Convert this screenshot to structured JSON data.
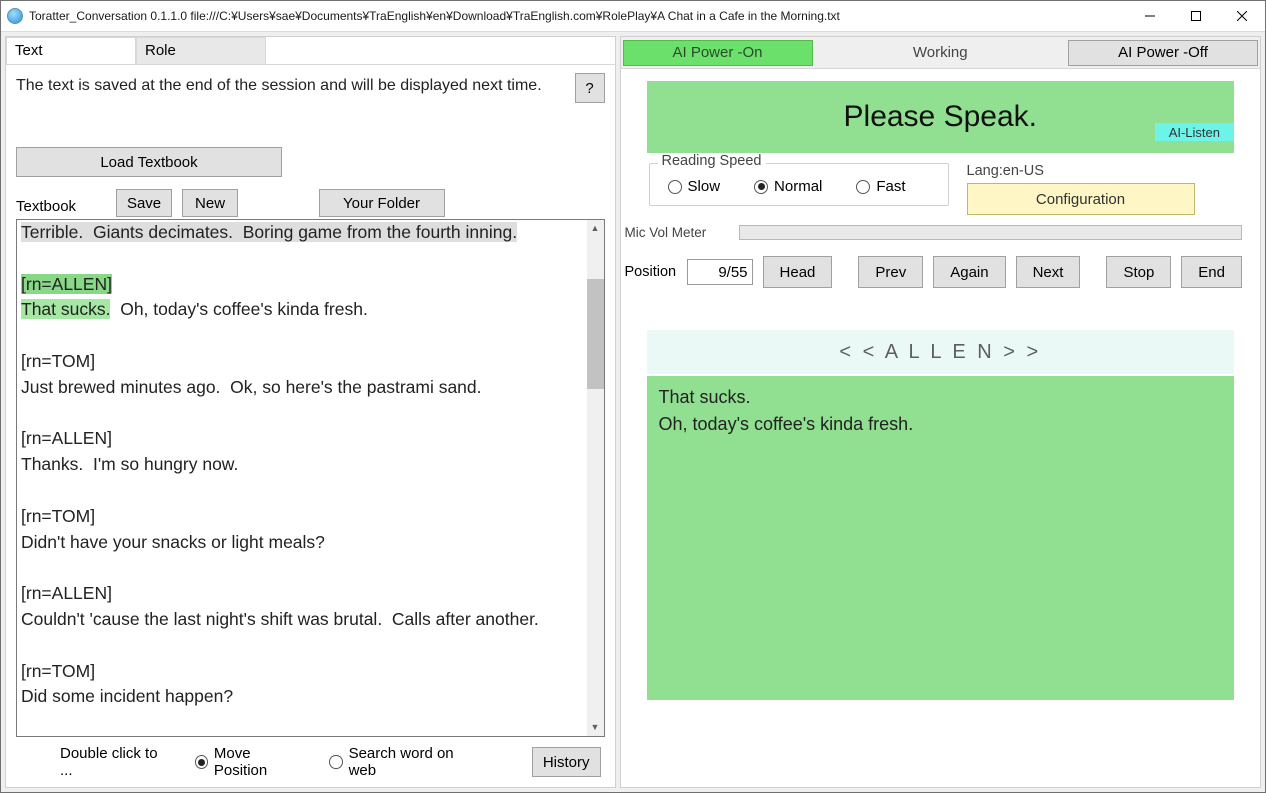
{
  "window": {
    "title": "Toratter_Conversation 0.1.1.0   file:///C:¥Users¥sae¥Documents¥TraEnglish¥en¥Download¥TraEnglish.com¥RolePlay¥A Chat in a Cafe in the Morning.txt"
  },
  "tabs": {
    "text": "Text",
    "role": "Role"
  },
  "left": {
    "save_msg": "The text is saved at the end of the session and will be displayed next time.",
    "help": "?",
    "load_btn": "Load Textbook",
    "textbook_label": "Textbook",
    "save_btn": "Save",
    "new_btn": "New",
    "folder_btn": "Your Folder",
    "textbook_content": {
      "line1": "Terrible.  Giants decimates.  Boring game from the fourth inning.",
      "allen_tag": "[rn=ALLEN]",
      "allen_hl": "That sucks.",
      "allen_rest": "  Oh, today's coffee's kinda fresh.",
      "rest": "\n[rn=TOM]\nJust brewed minutes ago.  Ok, so here's the pastrami sand.\n\n[rn=ALLEN]\nThanks.  I'm so hungry now.\n\n[rn=TOM]\nDidn't have your snacks or light meals?\n\n[rn=ALLEN]\nCouldn't 'cause the last night's shift was brutal.  Calls after another.\n\n[rn=TOM]\nDid some incident happen?"
    },
    "bottom": {
      "dbl": "Double click to ...",
      "move": "Move Position",
      "search": "Search word on web",
      "history": "History"
    }
  },
  "right": {
    "ai_on": "AI Power -On",
    "status": "Working",
    "ai_off": "AI Power -Off",
    "speak": "Please Speak.",
    "ai_listen": "AI-Listen",
    "speed_legend": "Reading Speed",
    "speed": {
      "slow": "Slow",
      "normal": "Normal",
      "fast": "Fast"
    },
    "lang": "Lang:en-US",
    "config": "Configuration",
    "mic_label": "Mic Vol Meter",
    "pos_label": "Position",
    "pos_value": "9/55",
    "nav": {
      "head": "Head",
      "prev": "Prev",
      "again": "Again",
      "next": "Next",
      "stop": "Stop",
      "end": "End"
    },
    "role_banner": "< <   A L L E N   > >",
    "line_text": "That sucks.\nOh, today's coffee's kinda fresh."
  }
}
